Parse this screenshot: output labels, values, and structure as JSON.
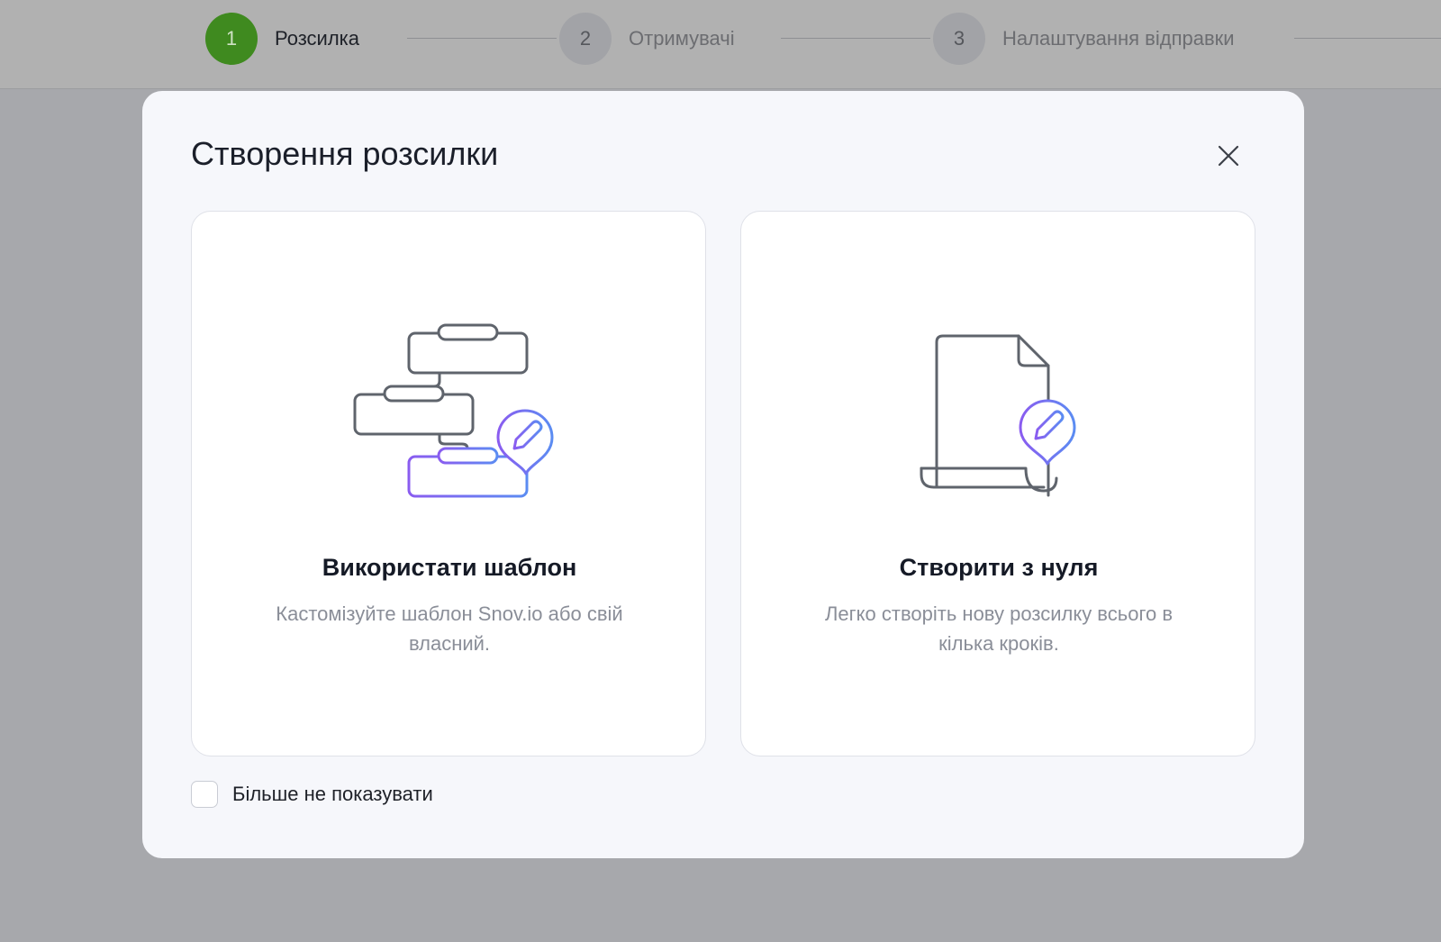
{
  "stepper": {
    "steps": [
      {
        "number": "1",
        "label": "Розсилка",
        "active": true
      },
      {
        "number": "2",
        "label": "Отримувачі",
        "active": false
      },
      {
        "number": "3",
        "label": "Налаштування відправки",
        "active": false
      }
    ]
  },
  "modal": {
    "title": "Створення розсилки",
    "close_icon": "close-icon",
    "options": [
      {
        "icon": "template-blocks-icon",
        "title": "Використати шаблон",
        "description": "Кастомізуйте шаблон Snov.io або свій власний."
      },
      {
        "icon": "blank-document-icon",
        "title": "Створити з нуля",
        "description": "Легко створіть нову розсилку всього в кілька кроків."
      }
    ],
    "dont_show_again": {
      "label": "Більше не показувати",
      "checked": false
    }
  },
  "colors": {
    "step_active": "#3f8a1f",
    "accent_gradient_start": "#8a5cf0",
    "accent_gradient_end": "#5b8cf2",
    "icon_stroke": "#5f646c"
  }
}
